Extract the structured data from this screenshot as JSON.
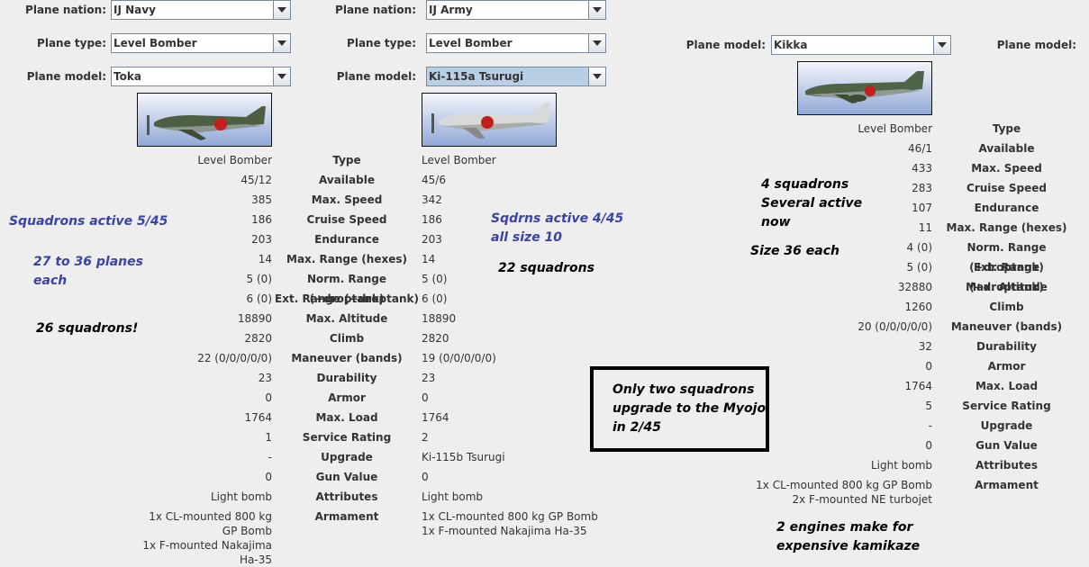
{
  "colors": {
    "background": "#eeeeee",
    "note_blue": "#3a43a8",
    "selected_combo": "#b8cfe5"
  },
  "panel1": {
    "nation_label": "Plane nation:",
    "nation_value": "IJ Navy",
    "type_label": "Plane type:",
    "type_value": "Level Bomber",
    "model_label": "Plane model:",
    "model_value": "Toka"
  },
  "panel2": {
    "nation_label": "Plane nation:",
    "nation_value": "IJ Army",
    "type_label": "Plane type:",
    "type_value": "Level Bomber",
    "model_label": "Plane model:",
    "model_value": "Ki-115a Tsurugi"
  },
  "panel3": {
    "model_label": "Plane model:",
    "model_value": "Kikka",
    "model2_label": "Plane model:"
  },
  "stat_labels": [
    "Type",
    "Available",
    "Max. Speed",
    "Cruise Speed",
    "Endurance",
    "Max. Range (hexes)",
    "Norm. Range (+droptank)",
    "Ext. Range (+droptank)",
    "Max. Altitude",
    "Climb",
    "Maneuver (bands)",
    "Durability",
    "Armor",
    "Max. Load",
    "Service Rating",
    "Upgrade",
    "Gun Value",
    "Attributes",
    "Armament"
  ],
  "toka_values": [
    "Level Bomber",
    "45/12",
    "385",
    "186",
    "203",
    "14",
    "5 (0)",
    "6 (0)",
    "18890",
    "2820",
    "22 (0/0/0/0/0)",
    "23",
    "0",
    "1764",
    "1",
    "-",
    "0",
    "Light bomb"
  ],
  "toka_armament": [
    "1x CL-mounted 800 kg GP Bomb",
    "1x F-mounted Nakajima Ha-35"
  ],
  "tsurugi_values": [
    "Level Bomber",
    "45/6",
    "342",
    "186",
    "203",
    "14",
    "5 (0)",
    "6 (0)",
    "18890",
    "2820",
    "19 (0/0/0/0/0)",
    "23",
    "0",
    "1764",
    "2",
    "Ki-115b Tsurugi",
    "0",
    "Light bomb"
  ],
  "tsurugi_armament": [
    "1x CL-mounted 800 kg GP Bomb",
    "1x F-mounted Nakajima Ha-35"
  ],
  "kikka_values": [
    "Level Bomber",
    "46/1",
    "433",
    "283",
    "107",
    "11",
    "4 (0)",
    "5 (0)",
    "32880",
    "1260",
    "20 (0/0/0/0/0)",
    "32",
    "0",
    "1764",
    "5",
    "-",
    "0",
    "Light bomb"
  ],
  "kikka_armament": [
    "1x CL-mounted 800 kg GP Bomb",
    "2x F-mounted NE turbojet"
  ],
  "notes": {
    "squadrons_active": "Squadrons active 5/45",
    "planes_each": "27 to 36 planes\neach",
    "squadrons_26": "26 squadrons!",
    "sqdrns_active": "Sqdrns active 4/45\nall size 10",
    "squadrons_22": "22 squadrons",
    "four_squadrons": "4 squadrons\nSeveral active\nnow",
    "size_36": "Size 36 each",
    "only_two": "Only two squadrons\nupgrade to the Myojo\nin 2/45",
    "two_engines": "2 engines make for\nexpensive kamikaze"
  }
}
